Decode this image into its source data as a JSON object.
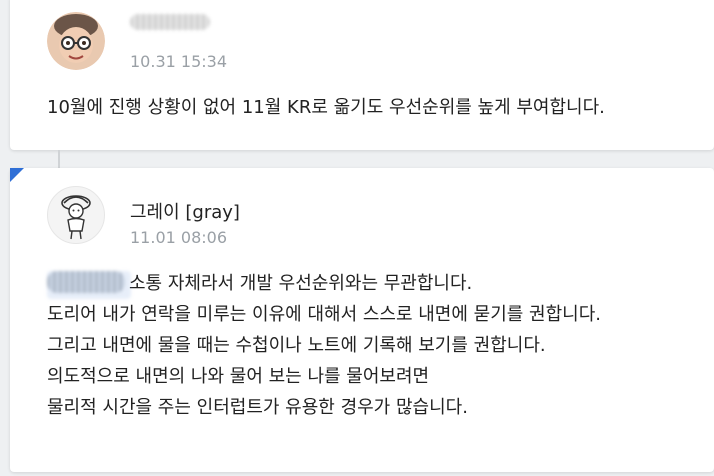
{
  "comments": [
    {
      "author": "",
      "author_redacted": true,
      "timestamp": "10.31 15:34",
      "avatar_icon": "memoji-avatar-icon",
      "lines": [
        "10월에 진행 상황이 없어 11월 KR로 옮기도 우선순위를 높게 부여합니다."
      ]
    },
    {
      "author": "그레이 [gray]",
      "timestamp": "11.01 08:06",
      "avatar_icon": "sketch-avatar-icon",
      "mention_redacted": true,
      "lines": [
        "소통 자체라서 개발 우선순위와는 무관합니다.",
        "도리어 내가 연락을 미루는 이유에 대해서 스스로 내면에 묻기를 권합니다.",
        "그리고 내면에 물을 때는 수첩이나 노트에 기록해 보기를 권합니다.",
        "의도적으로 내면의 나와 물어 보는 나를 물어보려면",
        "물리적 시간을 주는 인터럽트가 유용한 경우가 많습니다."
      ]
    }
  ],
  "colors": {
    "accent_flag": "#2f6fd6",
    "timestamp": "#9aa0a6",
    "background": "#eef0f2"
  }
}
